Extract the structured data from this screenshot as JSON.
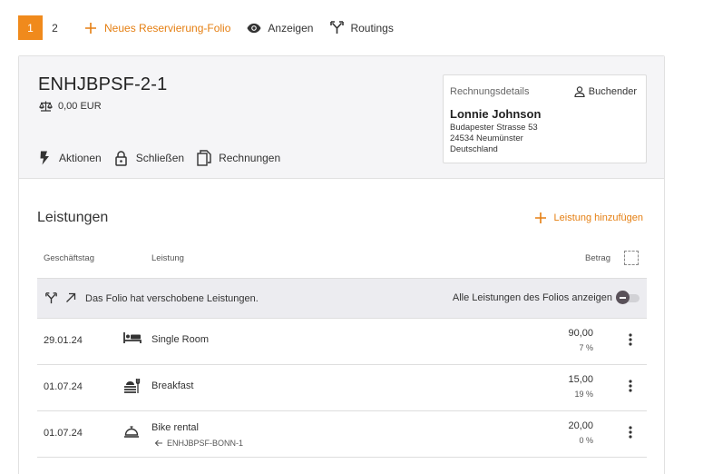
{
  "topbar": {
    "pages": [
      "1",
      "2"
    ],
    "active_page": "1",
    "new_folio_label": "Neues Reservierung-Folio",
    "show_label": "Anzeigen",
    "routings_label": "Routings"
  },
  "folio": {
    "title": "ENHJBPSF-2-1",
    "balance": "0,00 EUR",
    "actions": {
      "actions_label": "Aktionen",
      "close_label": "Schließen",
      "invoices_label": "Rechnungen"
    }
  },
  "billing": {
    "label": "Rechnungsdetails",
    "booker_label": "Buchender",
    "name": "Lonnie Johnson",
    "address_line1": "Budapester Strasse 53",
    "address_line2": "24534 Neumünster",
    "address_line3": "Deutschland"
  },
  "services": {
    "title": "Leistungen",
    "add_label": "Leistung hinzufügen",
    "columns": {
      "date": "Geschäftstag",
      "service": "Leistung",
      "amount": "Betrag"
    },
    "banner": {
      "text": "Das Folio hat verschobene Leistungen.",
      "toggle_label": "Alle Leistungen des Folios anzeigen",
      "toggle_on": false
    },
    "rows": [
      {
        "date": "29.01.24",
        "icon": "bed-icon",
        "name": "Single Room",
        "amount": "90,00",
        "vat": "7 %"
      },
      {
        "date": "01.07.24",
        "icon": "breakfast-icon",
        "name": "Breakfast",
        "amount": "15,00",
        "vat": "19 %"
      },
      {
        "date": "01.07.24",
        "icon": "cloche-icon",
        "name": "Bike rental",
        "origin": "ENHJBPSF-BONN-1",
        "amount": "20,00",
        "vat": "0 %"
      }
    ]
  },
  "colors": {
    "accent": "#f08a1c",
    "accent_text": "#e57f12",
    "header_bg": "#f5f5f7",
    "banner_bg": "#ececf0"
  }
}
